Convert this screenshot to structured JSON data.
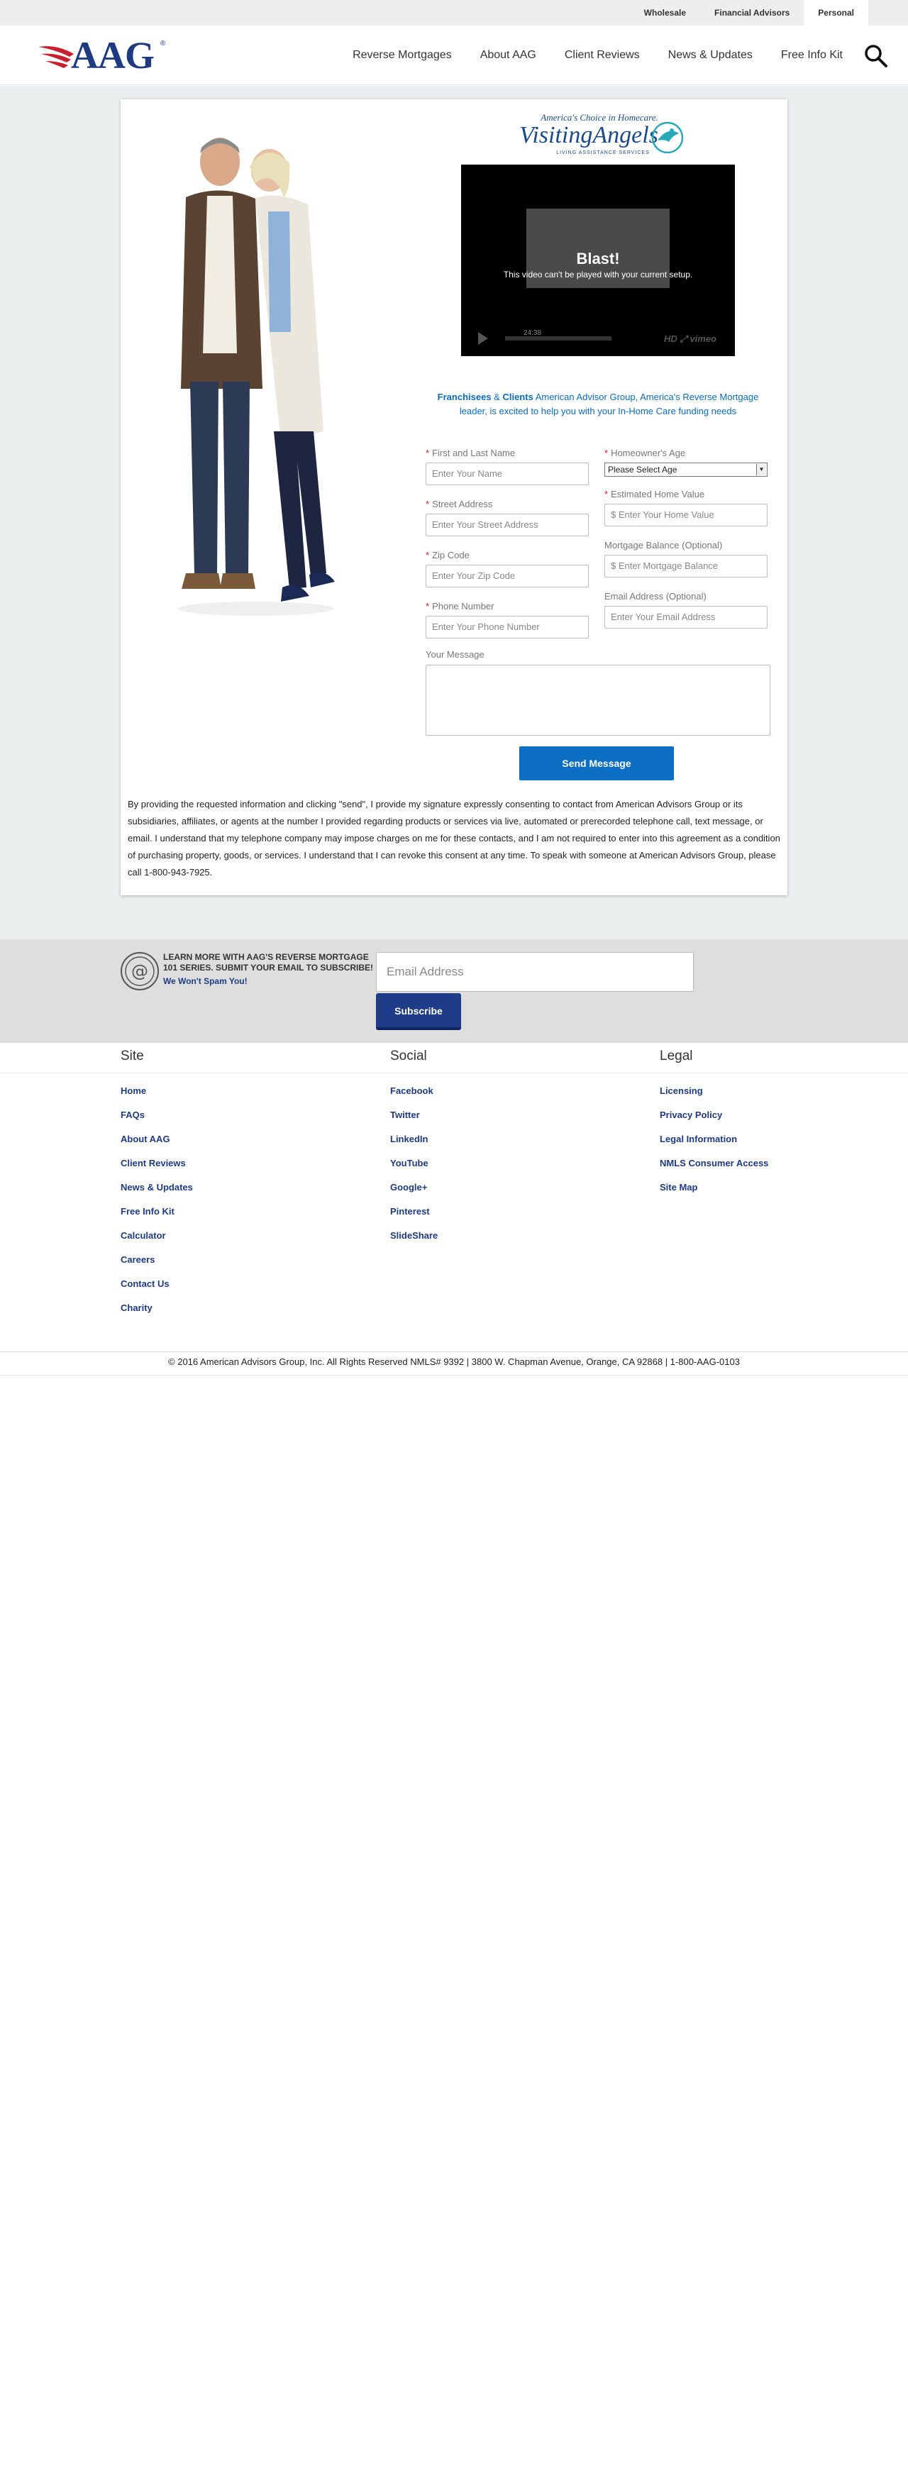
{
  "topbar": {
    "links": [
      {
        "label": "Wholesale"
      },
      {
        "label": "Financial Advisors"
      },
      {
        "label": "Personal"
      }
    ]
  },
  "header": {
    "logo_text": "AAG",
    "logo_reg": "®",
    "nav": [
      {
        "label": "Reverse Mortgages"
      },
      {
        "label": "About AAG"
      },
      {
        "label": "Client Reviews"
      },
      {
        "label": "News & Updates"
      },
      {
        "label": "Free Info Kit"
      }
    ]
  },
  "partner": {
    "tagline": "America's Choice in Homecare.",
    "name": "VisitingAngels",
    "sub": "LIVING ASSISTANCE SERVICES"
  },
  "video": {
    "title": "Blast!",
    "message": "This video can't be played with your current setup.",
    "duration": "24:38",
    "controls": "HD ⤢ vimeo"
  },
  "intro": {
    "bold1": "Franchisees",
    "amp": " & ",
    "bold2": "Clients",
    "text": " American Advisor Group, America's Reverse Mortgage leader, is excited to help you with your In-Home Care funding needs"
  },
  "form": {
    "name": {
      "label": "First and Last Name",
      "placeholder": "Enter Your Name"
    },
    "street": {
      "label": "Street Address",
      "placeholder": "Enter Your Street Address"
    },
    "zip": {
      "label": "Zip Code",
      "placeholder": "Enter Your Zip Code"
    },
    "phone": {
      "label": "Phone Number",
      "placeholder": "Enter Your Phone Number"
    },
    "age": {
      "label": "Homeowner's Age",
      "selected": "Please Select Age"
    },
    "home_value": {
      "label": "Estimated Home Value",
      "placeholder": "$ Enter Your Home Value"
    },
    "mortgage": {
      "label": "Mortgage Balance (Optional)",
      "placeholder": "$ Enter Mortgage Balance"
    },
    "email": {
      "label": "Email Address (Optional)",
      "placeholder": "Enter Your Email Address"
    },
    "message_label": "Your Message",
    "send_label": "Send Message",
    "required_mark": "*"
  },
  "consent": "By providing the requested information and clicking \"send\", I provide my signature expressly consenting to contact from American Advisors Group or its subsidiaries, affiliates, or agents at the number I provided regarding products or services via live, automated or prerecorded telephone call, text message, or email. I understand that my telephone company may impose charges on me for these contacts, and I am not required to enter into this agreement as a condition of purchasing property, goods, or services. I understand that I can revoke this consent at any time. To speak with someone at American Advisors Group, please call 1-800-943-7925.",
  "subscribe": {
    "heading": "LEARN MORE WITH AAG'S REVERSE MORTGAGE 101 SERIES. SUBMIT YOUR EMAIL TO SUBSCRIBE!",
    "spam": "We Won't Spam You!",
    "placeholder": "Email Address",
    "button": "Subscribe"
  },
  "footer": {
    "site": {
      "heading": "Site",
      "links": [
        "Home",
        "FAQs",
        "About AAG",
        "Client Reviews",
        "News & Updates",
        "Free Info Kit",
        "Calculator",
        "Careers",
        "Contact Us",
        "Charity"
      ]
    },
    "social": {
      "heading": "Social",
      "links": [
        "Facebook",
        "Twitter",
        "LinkedIn",
        "YouTube",
        "Google+",
        "Pinterest",
        "SlideShare"
      ]
    },
    "legal": {
      "heading": "Legal",
      "links": [
        "Licensing",
        "Privacy Policy",
        "Legal Information",
        "NMLS Consumer Access",
        "Site Map"
      ]
    },
    "copyright": "© 2016 American Advisors Group, Inc. All Rights Reserved NMLS# 9392 | 3800 W. Chapman Avenue, Orange, CA 92868 | 1-800-AAG-0103"
  },
  "colors": {
    "brand_navy": "#1e3a80",
    "accent_blue": "#0d6fc4",
    "required_red": "#dd2222"
  }
}
